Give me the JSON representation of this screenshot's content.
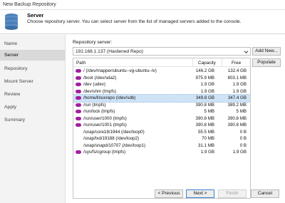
{
  "window": {
    "title": "New Backup Repository"
  },
  "header": {
    "title": "Server",
    "description": "Choose repository server. You can select server from the list of managed servers added to the console."
  },
  "sidebar": {
    "items": [
      {
        "label": "Name",
        "active": false
      },
      {
        "label": "Server",
        "active": true
      },
      {
        "label": "Repository",
        "active": false
      },
      {
        "label": "Mount Server",
        "active": false
      },
      {
        "label": "Review",
        "active": false
      },
      {
        "label": "Apply",
        "active": false
      },
      {
        "label": "Summary",
        "active": false
      }
    ]
  },
  "server": {
    "label": "Repository server:",
    "selected": "192.168.1.137 (Hardened Repo)"
  },
  "buttons": {
    "add_new": "Add New...",
    "populate": "Populate",
    "previous": "< Previous",
    "next": "Next >",
    "finish": "Finish",
    "cancel": "Cancel"
  },
  "table": {
    "columns": [
      "Path",
      "Capacity",
      "Free"
    ],
    "rows": [
      {
        "path": "/ (/dev/mapper/ubuntu--vg-ubuntu--lv)",
        "capacity": "146.2 GB",
        "free": "132.4 GB",
        "icon": true
      },
      {
        "path": "/boot (/dev/sda2)",
        "capacity": "975.9 MB",
        "free": "803.1 MB",
        "icon": true
      },
      {
        "path": "/dev (udev)",
        "capacity": "1.9 GB",
        "free": "1.9 GB",
        "icon": true
      },
      {
        "path": "/dev/shm (tmpfs)",
        "capacity": "1.9 GB",
        "free": "1.9 GB",
        "icon": true
      },
      {
        "path": "/home/linuxrepo (/dev/sdb)",
        "capacity": "349.8 GB",
        "free": "347.4 GB",
        "icon": true,
        "selected": true
      },
      {
        "path": "/run (tmpfs)",
        "capacity": "390.8 MB",
        "free": "389.2 MB",
        "icon": true
      },
      {
        "path": "/run/lock (tmpfs)",
        "capacity": "5 MB",
        "free": "5 MB",
        "icon": true
      },
      {
        "path": "/run/user/1000 (tmpfs)",
        "capacity": "390.8 MB",
        "free": "390.8 MB",
        "icon": true
      },
      {
        "path": "/run/user/1001 (tmpfs)",
        "capacity": "390.8 MB",
        "free": "390.8 MB",
        "icon": true
      },
      {
        "path": "/snap/core18/1944 (/dev/loop0)",
        "capacity": "55.5 MB",
        "free": "0 B",
        "icon": false
      },
      {
        "path": "/snap/lxd/19188 (/dev/loop2)",
        "capacity": "70 MB",
        "free": "0 B",
        "icon": false
      },
      {
        "path": "/snap/snapd/10707 (/dev/loop1)",
        "capacity": "31.1 MB",
        "free": "0 B",
        "icon": false
      },
      {
        "path": "/sys/fs/cgroup (tmpfs)",
        "capacity": "1.9 GB",
        "free": "1.9 GB",
        "icon": true
      }
    ]
  },
  "colors": {
    "disk_icon": "#a21fa0",
    "selection": "#cfe3f7",
    "sidebar_bg": "#f3f3f3",
    "sidebar_active": "#d9d9d9"
  }
}
